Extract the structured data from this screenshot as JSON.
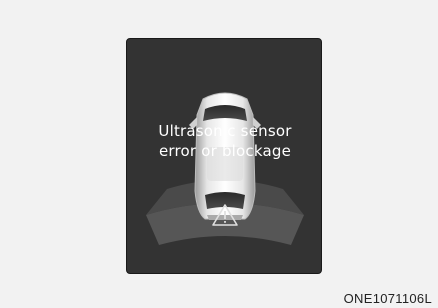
{
  "display": {
    "message_line1": "Ultrasonic sensor",
    "message_line2": "error or blockage",
    "warning_icon": "warning-triangle-icon",
    "vehicle_icon": "car-top-view-icon"
  },
  "figure_code": "ONE1071106L",
  "colors": {
    "page_background": "#f2f2f2",
    "panel_background": "#333333",
    "text": "#ffffff",
    "sensor_arc": "#555555"
  }
}
